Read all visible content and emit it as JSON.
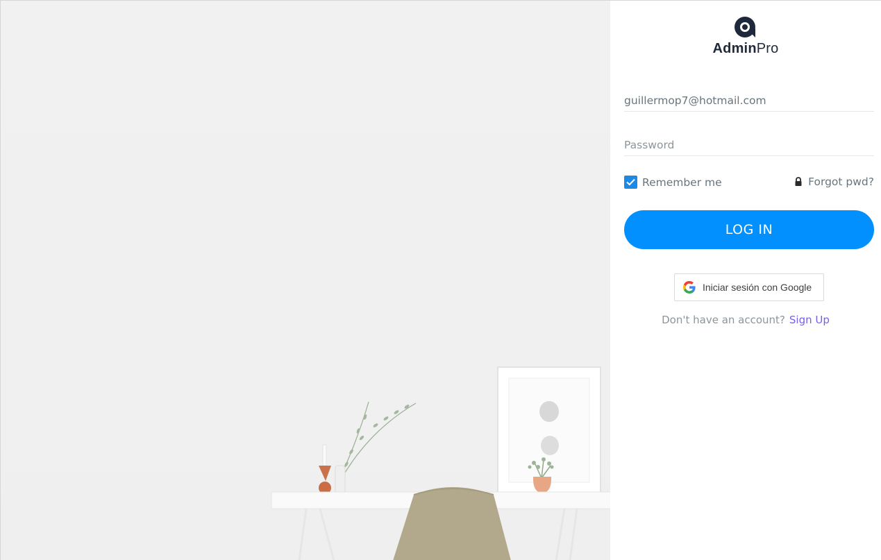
{
  "brand": {
    "name_bold": "Admin",
    "name_light": "Pro",
    "logo_icon": "adminpro-logo-icon",
    "color": "#1e2a3b"
  },
  "login_form": {
    "email_value": "guillermop7@hotmail.com",
    "password_placeholder": "Password",
    "remember_label": "Remember me",
    "remember_checked": true,
    "forgot_label": "Forgot pwd?",
    "forgot_icon": "lock-icon",
    "login_button": "LOG IN",
    "google_button": "Iniciar sesión con Google",
    "google_icon": "google-icon",
    "signup_prompt": "Don't have an account?",
    "signup_link": "Sign Up"
  },
  "colors": {
    "primary": "#0390ff",
    "checkbox": "#1e88e5",
    "link": "#7460ee",
    "text_muted": "#67757c"
  }
}
